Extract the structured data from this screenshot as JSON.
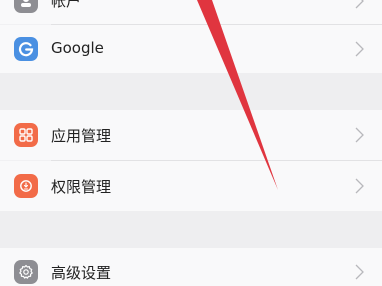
{
  "settings": {
    "items": [
      {
        "label": "帐户",
        "icon": "account-icon",
        "color": "#8e8e93"
      },
      {
        "label": "Google",
        "icon": "google-icon",
        "color": "#4a90e2"
      },
      {
        "label": "应用管理",
        "icon": "apps-grid-icon",
        "color": "#f26b48"
      },
      {
        "label": "权限管理",
        "icon": "permission-shield-icon",
        "color": "#f26b48"
      },
      {
        "label": "高级设置",
        "icon": "gear-icon",
        "color": "#8e8e93"
      }
    ]
  },
  "annotation": {
    "arrow_color": "#e0353f"
  }
}
